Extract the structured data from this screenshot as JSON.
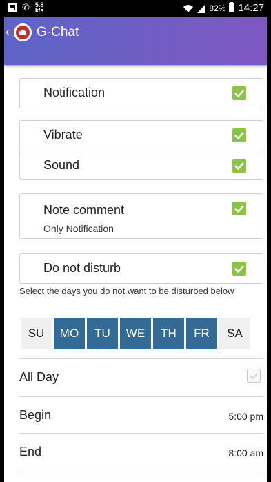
{
  "status_bar": {
    "net_speed_value": "5.8",
    "net_speed_unit": "k/s",
    "battery": "82%",
    "time": "14:27"
  },
  "app_bar": {
    "title": "G-Chat"
  },
  "settings": {
    "notification": {
      "label": "Notification",
      "checked": true
    },
    "vibrate": {
      "label": "Vibrate",
      "checked": true
    },
    "sound": {
      "label": "Sound",
      "checked": true
    },
    "note_comment": {
      "label": "Note comment",
      "sublabel": "Only Notification",
      "checked": true
    },
    "do_not_disturb": {
      "label": "Do not disturb",
      "checked": true
    }
  },
  "dnd_hint": "Select the days you do not want to be disturbed below",
  "days": [
    {
      "label": "SU",
      "selected": false
    },
    {
      "label": "MO",
      "selected": true
    },
    {
      "label": "TU",
      "selected": true
    },
    {
      "label": "WE",
      "selected": true
    },
    {
      "label": "TH",
      "selected": true
    },
    {
      "label": "FR",
      "selected": true
    },
    {
      "label": "SA",
      "selected": false
    }
  ],
  "all_day": {
    "label": "All Day",
    "checked": true,
    "disabled": true
  },
  "begin": {
    "label": "Begin",
    "value": "5:00 pm"
  },
  "end": {
    "label": "End",
    "value": "8:00 am"
  },
  "colors": {
    "accent_green": "#8bc34a",
    "day_selected": "#336b96",
    "appbar_start": "#5e64c6",
    "appbar_end": "#7e58c2"
  }
}
